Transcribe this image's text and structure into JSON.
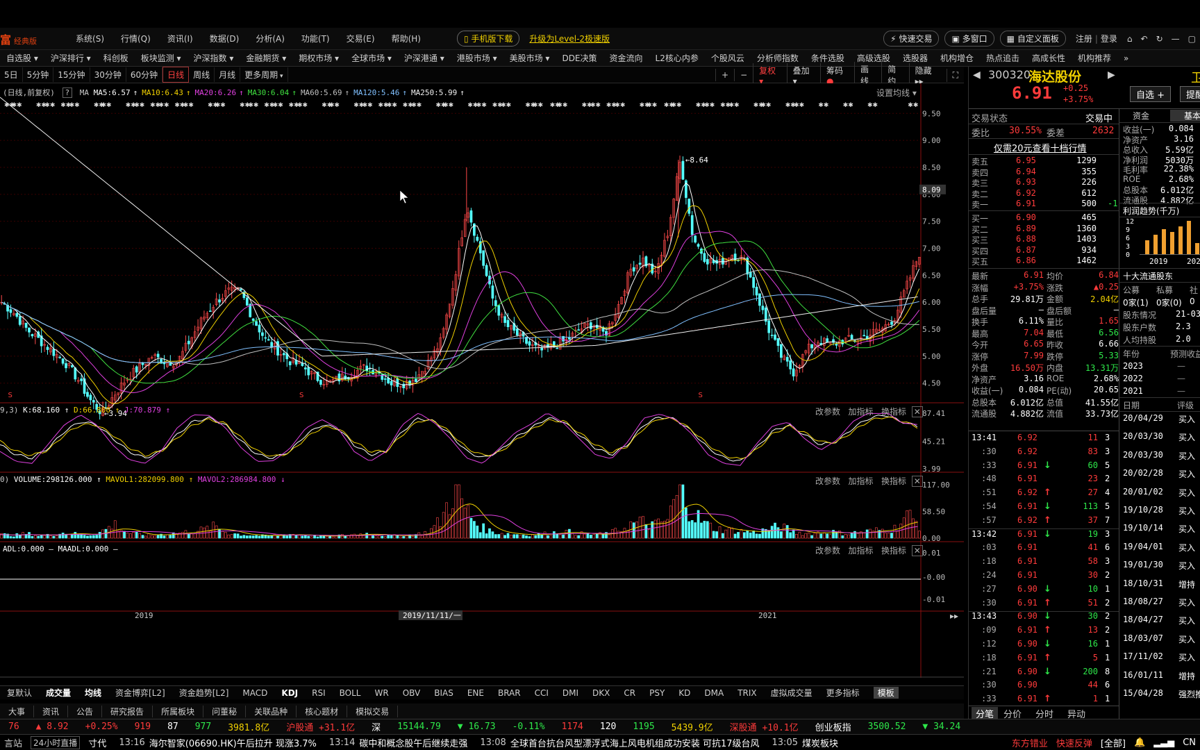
{
  "menubar": {
    "logo": "富",
    "logo_sub": "经典版",
    "items": [
      "系统(S)",
      "行情(Q)",
      "资讯(I)",
      "数据(D)",
      "分析(A)",
      "功能(T)",
      "交易(E)",
      "帮助(H)"
    ],
    "mobile_download": "手机版下载",
    "upgrade_link": "升级为Level-2极速版",
    "quick_trade": "快速交易",
    "multi_window": "多窗口",
    "custom_panel": "自定义面板",
    "register": "注册",
    "login": "登录"
  },
  "navbar": [
    "自选股",
    "沪深排行",
    "科创板",
    "板块监测",
    "沪深指数",
    "金融期货",
    "期权市场",
    "全球市场",
    "沪深港通",
    "港股市场",
    "美股市场",
    "DDE决策",
    "资金流向",
    "L2核心内参",
    "个股风云",
    "分析师指数",
    "条件选股",
    "高级选股",
    "选股器",
    "机构增仓",
    "热点追击",
    "高成长性",
    "机构推荐",
    "»"
  ],
  "periodbar": {
    "items": [
      "5日",
      "5分钟",
      "15分钟",
      "30分钟",
      "60分钟",
      "日线",
      "周线",
      "月线",
      "更多周期"
    ],
    "active": "日线"
  },
  "chart_tools": [
    "+",
    "−",
    "复权",
    "叠加",
    "筹码",
    "画线",
    "简约",
    "隐藏"
  ],
  "ma_legend": {
    "prefix": "(日线,前复权)",
    "ma": "MA",
    "items": [
      {
        "text": "MA5:6.57",
        "color": "#ffffff"
      },
      {
        "text": "MA10:6.43",
        "color": "#f0d000"
      },
      {
        "text": "MA20:6.26",
        "color": "#e040e0"
      },
      {
        "text": "MA30:6.04",
        "color": "#40e040"
      },
      {
        "text": "MA60:5.69",
        "color": "#c0c0c0"
      },
      {
        "text": "MA120:5.46",
        "color": "#80c0ff"
      },
      {
        "text": "MA250:5.99",
        "color": "#f0f0f0"
      }
    ],
    "settings": "设置均线"
  },
  "kdj_legend": {
    "prefix": "9,3)",
    "k": "K:68.160",
    "d": "D:66.800",
    "j": "J:70.879"
  },
  "vol_legend": {
    "prefix": "0)",
    "volume": "VOLUME:298126.000",
    "mavol1": "MAVOL1:282099.800",
    "mavol2": "MAVOL2:286984.800"
  },
  "adl_legend": {
    "text": "ADL:0.000 — MAADL:0.000 —"
  },
  "panel_tools": [
    "改参数",
    "加指标",
    "换指标"
  ],
  "chart_data": [
    {
      "type": "candlestick",
      "title": "",
      "y_ticks": [
        9.5,
        9.0,
        8.5,
        8.09,
        8.0,
        7.5,
        7.0,
        6.5,
        6.0,
        5.5,
        5.0,
        4.5
      ],
      "current_price_marker": 8.09,
      "ylim": [
        4.2,
        9.8
      ],
      "x_ticks": [
        "2019",
        "2019/11/11/一",
        "2021"
      ],
      "annotations": [
        {
          "label": "8.64"
        },
        {
          "label": "3.94"
        }
      ],
      "close_series": [
        6.0,
        5.8,
        5.5,
        5.3,
        5.1,
        4.9,
        4.6,
        4.2,
        3.94,
        4.3,
        4.6,
        4.8,
        5.0,
        4.9,
        4.9,
        5.3,
        5.7,
        6.0,
        6.2,
        6.2,
        5.7,
        5.3,
        5.1,
        4.9,
        4.8,
        4.6,
        4.5,
        4.6,
        4.7,
        4.8,
        4.7,
        4.5,
        4.5,
        4.6,
        4.9,
        5.3,
        6.4,
        7.8,
        7.0,
        6.1,
        5.6,
        5.4,
        5.2,
        5.1,
        5.2,
        5.3,
        5.5,
        5.6,
        5.4,
        5.9,
        6.6,
        6.8,
        6.5,
        7.3,
        8.64,
        7.2,
        6.8,
        6.7,
        6.9,
        6.8,
        6.2,
        5.5,
        5.0,
        4.7,
        5.1,
        5.3,
        5.2,
        5.3,
        5.3,
        5.4,
        5.5,
        5.7,
        6.3,
        6.91
      ],
      "ma_series_note_free": true
    },
    {
      "type": "line",
      "title": "",
      "y_ticks": [
        87.41,
        45.21,
        3.99
      ],
      "ylim": [
        3.99,
        87.41
      ],
      "series": [
        {
          "name": "K",
          "values": [
            40,
            25,
            20,
            35,
            60,
            75,
            70,
            50,
            30,
            20,
            30,
            55,
            75,
            80,
            70,
            45,
            25,
            20,
            30,
            55,
            70,
            65,
            40,
            25,
            30,
            60,
            80,
            75,
            55,
            30,
            20,
            30,
            50,
            65,
            80,
            75,
            55,
            35,
            25,
            40,
            70,
            82,
            78,
            60,
            35,
            20,
            15,
            35,
            60,
            70,
            55,
            40,
            45,
            65,
            80,
            85,
            75,
            68
          ]
        },
        {
          "name": "D",
          "values": [
            45,
            30,
            24,
            32,
            55,
            70,
            70,
            55,
            36,
            24,
            30,
            50,
            70,
            78,
            72,
            50,
            30,
            22,
            28,
            50,
            66,
            65,
            45,
            30,
            30,
            55,
            76,
            76,
            58,
            35,
            24,
            28,
            46,
            62,
            76,
            76,
            58,
            40,
            28,
            38,
            65,
            80,
            78,
            62,
            40,
            24,
            18,
            32,
            56,
            68,
            58,
            44,
            44,
            60,
            76,
            82,
            76,
            66.8
          ]
        }
      ]
    },
    {
      "type": "bar",
      "title": "",
      "y_ticks": [
        117.0,
        58.5,
        0.0
      ],
      "ylim": [
        0,
        117
      ],
      "values": [
        8,
        6,
        10,
        5,
        7,
        12,
        9,
        6,
        15,
        30,
        12,
        8,
        6,
        9,
        11,
        14,
        18,
        25,
        12,
        8,
        6,
        5,
        7,
        9,
        6,
        5,
        4,
        6,
        8,
        10,
        7,
        5,
        6,
        8,
        14,
        40,
        110,
        60,
        25,
        14,
        10,
        8,
        7,
        9,
        12,
        14,
        10,
        8,
        9,
        16,
        30,
        35,
        28,
        40,
        112,
        55,
        30,
        20,
        18,
        15,
        12,
        20,
        25,
        14,
        10,
        12,
        14,
        10,
        12,
        15,
        18,
        20,
        50,
        30
      ]
    },
    {
      "type": "line",
      "title": "",
      "y_ticks": [
        0.01,
        -0.0,
        -0.01
      ],
      "series": [
        {
          "name": "ADL",
          "values": [
            0,
            0
          ]
        }
      ]
    }
  ],
  "indicator_tabs": {
    "items": [
      "复默认",
      "成交量",
      "均线",
      "资金博弈[L2]",
      "资金趋势[L2]",
      "MACD",
      "KDJ",
      "RSI",
      "BOLL",
      "WR",
      "OBV",
      "BIAS",
      "ENE",
      "BRAR",
      "CCI",
      "DMI",
      "DKX",
      "CR",
      "PSY",
      "KD",
      "DMA",
      "TRIX",
      "虚拟成交量",
      "更多指标",
      "模板"
    ],
    "bold": [
      "成交量",
      "均线",
      "KDJ"
    ],
    "selected": "模板"
  },
  "info_tabs": [
    "大事",
    "资讯",
    "公告",
    "研究报告",
    "所属板块",
    "问董秘",
    "关联品种",
    "核心题材",
    "模拟交易"
  ],
  "stock": {
    "code": "300320",
    "name": "海达股份",
    "price": "6.91",
    "change": "+0.25",
    "change_pct": "+3.75%",
    "add_watch": "自选 +",
    "alert": "提醒",
    "side_char": "卫"
  },
  "order_book": {
    "status_label": "交易状态",
    "status_value": "交易中",
    "weibi_label": "委比",
    "weibi_value": "30.55%",
    "weicha_label": "委差",
    "weicha_value": "2632",
    "promo": "仅需20元查看十档行情",
    "asks": [
      {
        "label": "卖五",
        "price": "6.95",
        "vol": "1299",
        "chg": ""
      },
      {
        "label": "卖四",
        "price": "6.94",
        "vol": "355",
        "chg": ""
      },
      {
        "label": "卖三",
        "price": "6.93",
        "vol": "226",
        "chg": ""
      },
      {
        "label": "卖二",
        "price": "6.92",
        "vol": "612",
        "chg": ""
      },
      {
        "label": "卖一",
        "price": "6.91",
        "vol": "500",
        "chg": "-1"
      }
    ],
    "bids": [
      {
        "label": "买一",
        "price": "6.90",
        "vol": "465"
      },
      {
        "label": "买二",
        "price": "6.89",
        "vol": "1360"
      },
      {
        "label": "买三",
        "price": "6.88",
        "vol": "1403"
      },
      {
        "label": "买四",
        "price": "6.87",
        "vol": "934"
      },
      {
        "label": "买五",
        "price": "6.86",
        "vol": "1462"
      }
    ]
  },
  "quote_stats": [
    [
      {
        "k": "最新",
        "v": "6.91",
        "c": "red"
      },
      {
        "k": "均价",
        "v": "6.84",
        "c": "red"
      }
    ],
    [
      {
        "k": "涨幅",
        "v": "+3.75%",
        "c": "red"
      },
      {
        "k": "涨跌",
        "v": "▲0.25",
        "c": "red"
      }
    ],
    [
      {
        "k": "总手",
        "v": "29.81万",
        "c": "white"
      },
      {
        "k": "金额",
        "v": "2.04亿",
        "c": "yellow"
      }
    ],
    [
      {
        "k": "盘后量",
        "v": "—",
        "c": "white"
      },
      {
        "k": "盘后额",
        "v": "—",
        "c": "white"
      }
    ],
    [
      {
        "k": "换手",
        "v": "6.11%",
        "c": "white"
      },
      {
        "k": "量比",
        "v": "1.65",
        "c": "red"
      }
    ],
    [
      {
        "k": "最高",
        "v": "7.04",
        "c": "red"
      },
      {
        "k": "最低",
        "v": "6.56",
        "c": "green"
      }
    ],
    [
      {
        "k": "今开",
        "v": "6.65",
        "c": "red"
      },
      {
        "k": "昨收",
        "v": "6.66",
        "c": "white"
      }
    ],
    [
      {
        "k": "涨停",
        "v": "7.99",
        "c": "red"
      },
      {
        "k": "跌停",
        "v": "5.33",
        "c": "green"
      }
    ],
    [
      {
        "k": "外盘",
        "v": "16.50万",
        "c": "red"
      },
      {
        "k": "内盘",
        "v": "13.31万",
        "c": "green"
      }
    ],
    [
      {
        "k": "净资产",
        "v": "3.16",
        "c": "white"
      },
      {
        "k": "ROE",
        "v": "2.68%",
        "c": "white"
      }
    ],
    [
      {
        "k": "收益(一)",
        "v": "0.084",
        "c": "white"
      },
      {
        "k": "PE(动)",
        "v": "20.65",
        "c": "white"
      }
    ],
    [
      {
        "k": "总股本",
        "v": "6.012亿",
        "c": "white"
      },
      {
        "k": "总值",
        "v": "41.55亿",
        "c": "white"
      }
    ],
    [
      {
        "k": "流通股",
        "v": "4.882亿",
        "c": "white"
      },
      {
        "k": "流值",
        "v": "33.73亿",
        "c": "white"
      }
    ]
  ],
  "ticks": [
    {
      "t": "13:41",
      "p": "6.92",
      "a": "",
      "v": "11",
      "n": "3"
    },
    {
      "t": ":30",
      "p": "6.92",
      "a": "",
      "v": "83",
      "n": "3"
    },
    {
      "t": ":33",
      "p": "6.91",
      "a": "down",
      "v": "60",
      "n": "5"
    },
    {
      "t": ":48",
      "p": "6.91",
      "a": "",
      "v": "23",
      "n": "2"
    },
    {
      "t": ":51",
      "p": "6.92",
      "a": "up",
      "v": "27",
      "n": "4"
    },
    {
      "t": ":54",
      "p": "6.91",
      "a": "down",
      "v": "113",
      "n": "5"
    },
    {
      "t": ":57",
      "p": "6.92",
      "a": "up",
      "v": "37",
      "n": "7"
    },
    {
      "t": "13:42",
      "p": "6.91",
      "a": "down",
      "v": "19",
      "n": "3"
    },
    {
      "t": ":03",
      "p": "6.91",
      "a": "",
      "v": "41",
      "n": "6"
    },
    {
      "t": ":18",
      "p": "6.91",
      "a": "",
      "v": "58",
      "n": "3"
    },
    {
      "t": ":24",
      "p": "6.91",
      "a": "",
      "v": "30",
      "n": "2"
    },
    {
      "t": ":27",
      "p": "6.90",
      "a": "down",
      "v": "10",
      "n": "1"
    },
    {
      "t": ":30",
      "p": "6.91",
      "a": "up",
      "v": "51",
      "n": "2"
    },
    {
      "t": "13:43",
      "p": "6.90",
      "a": "down",
      "v": "30",
      "n": "2"
    },
    {
      "t": ":09",
      "p": "6.91",
      "a": "up",
      "v": "13",
      "n": "2"
    },
    {
      "t": ":12",
      "p": "6.90",
      "a": "down",
      "v": "16",
      "n": "1"
    },
    {
      "t": ":18",
      "p": "6.91",
      "a": "up",
      "v": "5",
      "n": "1"
    },
    {
      "t": ":21",
      "p": "6.90",
      "a": "down",
      "v": "200",
      "n": "8"
    },
    {
      "t": ":30",
      "p": "6.90",
      "a": "",
      "v": "44",
      "n": "6"
    },
    {
      "t": ":33",
      "p": "6.91",
      "a": "up",
      "v": "1",
      "n": "1"
    }
  ],
  "tick_tabs": [
    "分笔",
    "分价",
    "分时",
    "异动"
  ],
  "f10": {
    "tab_fund": "资金",
    "tab_basic": "基本",
    "rows": [
      {
        "k": "收益(一)",
        "v": "0.084"
      },
      {
        "k": "净资产",
        "v": "3.16"
      },
      {
        "k": "总收入",
        "v": "5.59亿"
      },
      {
        "k": "净利润",
        "v": "5030万"
      },
      {
        "k": "毛利率",
        "v": "22.38%"
      },
      {
        "k": "ROE",
        "v": "2.68%"
      },
      {
        "k": "总股本",
        "v": "6.012亿"
      },
      {
        "k": "流通股",
        "v": "4.882亿"
      }
    ],
    "profit_title": "利润趋势(千万)",
    "profit_y": [
      "12",
      "9",
      "6",
      "3",
      "0"
    ],
    "profit_x": [
      "2019",
      "202"
    ],
    "profit_values": [
      5,
      7,
      9,
      8,
      10,
      12,
      4,
      6
    ],
    "holders_title": "十大流通股东",
    "holder_cols": [
      "公募",
      "私募",
      "社"
    ],
    "holder_vals": [
      "0家(1)",
      "0家(0)",
      "0"
    ],
    "holder_rows": [
      {
        "k": "股东情况",
        "v": "21-03"
      },
      {
        "k": "股东户数",
        "v": "2.3"
      },
      {
        "k": "人均持股",
        "v": "2.0"
      }
    ],
    "year_header": [
      "年份",
      "预测收益"
    ],
    "years": [
      "2023",
      "2022",
      "2021"
    ],
    "date_header": [
      "日期",
      "评级"
    ],
    "dates": [
      {
        "d": "20/04/29",
        "r": "买入"
      },
      {
        "d": "20/03/30",
        "r": "买入"
      },
      {
        "d": "20/03/30",
        "r": "买入"
      },
      {
        "d": "20/02/28",
        "r": "买入"
      },
      {
        "d": "20/01/02",
        "r": "买入"
      },
      {
        "d": "19/10/28",
        "r": "买入"
      },
      {
        "d": "19/10/14",
        "r": "买入"
      },
      {
        "d": "19/04/01",
        "r": "买入"
      },
      {
        "d": "19/01/30",
        "r": "买入"
      },
      {
        "d": "18/10/31",
        "r": "增持"
      },
      {
        "d": "18/08/27",
        "r": "买入"
      },
      {
        "d": "18/04/27",
        "r": "买入"
      },
      {
        "d": "18/03/07",
        "r": "买入"
      },
      {
        "d": "17/11/02",
        "r": "买入"
      },
      {
        "d": "16/01/11",
        "r": "增持"
      },
      {
        "d": "15/04/28",
        "r": "强烈推"
      }
    ]
  },
  "indexbar": {
    "items": [
      {
        "text": "76",
        "c": "red"
      },
      {
        "text": "▲ 8.92",
        "c": "red"
      },
      {
        "text": "+0.25%",
        "c": "red"
      },
      {
        "text": "919",
        "c": "red"
      },
      {
        "text": "87",
        "c": "white"
      },
      {
        "text": "977",
        "c": "green"
      },
      {
        "text": "3981.8亿",
        "c": "yellow"
      },
      {
        "text": "沪股通 +31.1亿",
        "c": "red"
      },
      {
        "text": "深",
        "c": "white"
      },
      {
        "text": "15144.79",
        "c": "green"
      },
      {
        "text": "▼ 16.73",
        "c": "green"
      },
      {
        "text": "-0.11%",
        "c": "green"
      },
      {
        "text": "1174",
        "c": "red"
      },
      {
        "text": "120",
        "c": "white"
      },
      {
        "text": "1195",
        "c": "green"
      },
      {
        "text": "5439.9亿",
        "c": "yellow"
      },
      {
        "text": "深股通 +10.1亿",
        "c": "red"
      },
      {
        "text": "创业板指",
        "c": "white"
      },
      {
        "text": "3500.52",
        "c": "green"
      },
      {
        "text": "▼ 34.24",
        "c": "green"
      }
    ]
  },
  "newsbar": {
    "left": "言站",
    "live": "24小时直播",
    "items": [
      {
        "time": "",
        "text": "寸代"
      },
      {
        "time": "13:16",
        "text": "海尔智家(06690.HK)午后拉升  现涨3.7%"
      },
      {
        "time": "13:14",
        "text": "碳中和概念股午后继续走强"
      },
      {
        "time": "13:08",
        "text": "全球首台抗台风型漂浮式海上风电机组成功安装  可抗17级台风"
      },
      {
        "time": "13:05",
        "text": "煤炭板块"
      }
    ],
    "broker": "东方错业",
    "quick": "快速反弹",
    "all": "[全部]",
    "cn": "CN"
  }
}
